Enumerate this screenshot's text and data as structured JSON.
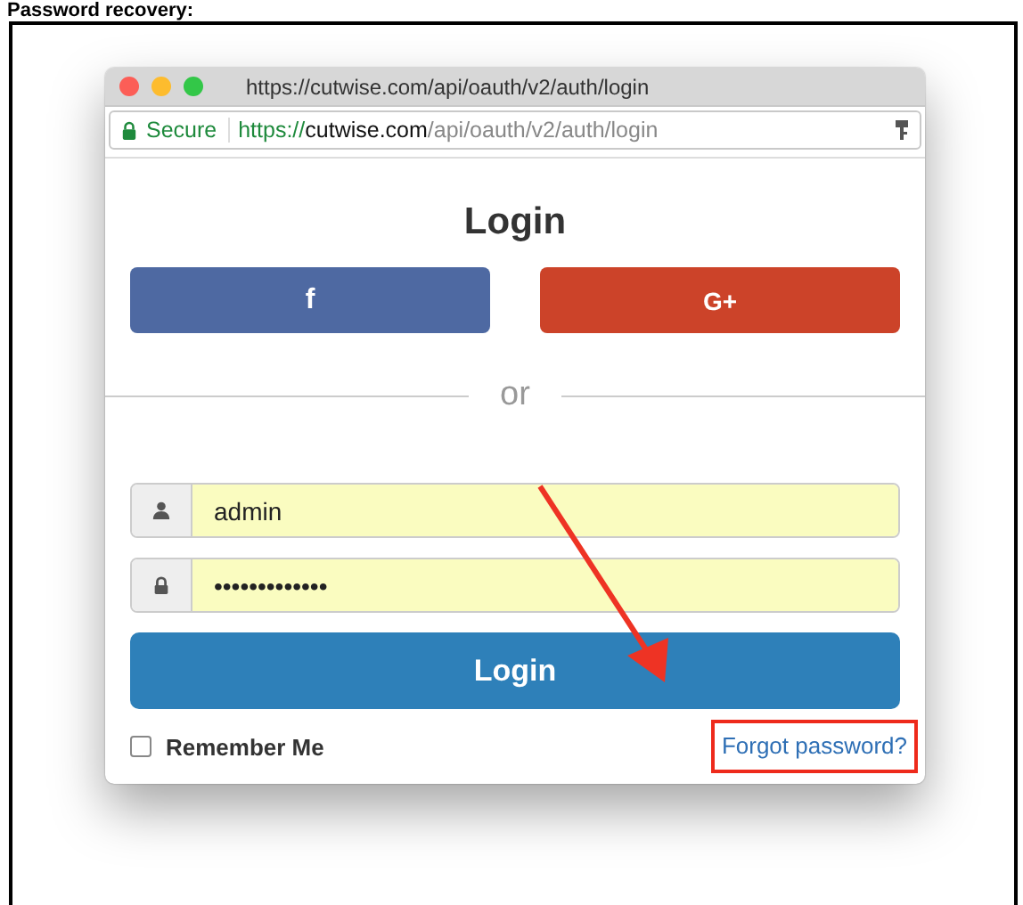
{
  "heading": "Password recovery:",
  "window": {
    "title": "https://cutwise.com/api/oauth/v2/auth/login",
    "secure_label": "Secure",
    "address": {
      "scheme": "https://",
      "host": "cutwise.com",
      "path": "/api/oauth/v2/auth/login"
    }
  },
  "login_form": {
    "title": "Login",
    "social_buttons": [
      {
        "kind": "facebook",
        "label": "f"
      },
      {
        "kind": "google",
        "label": "G+"
      }
    ],
    "divider_text": "or",
    "fields": [
      {
        "kind": "username",
        "value": "admin"
      },
      {
        "kind": "password",
        "value": "•••••••••••••"
      }
    ],
    "submit": "Login",
    "remember": {
      "label": "Remember Me",
      "checked": false
    },
    "forgot_link": "Forgot password?"
  }
}
